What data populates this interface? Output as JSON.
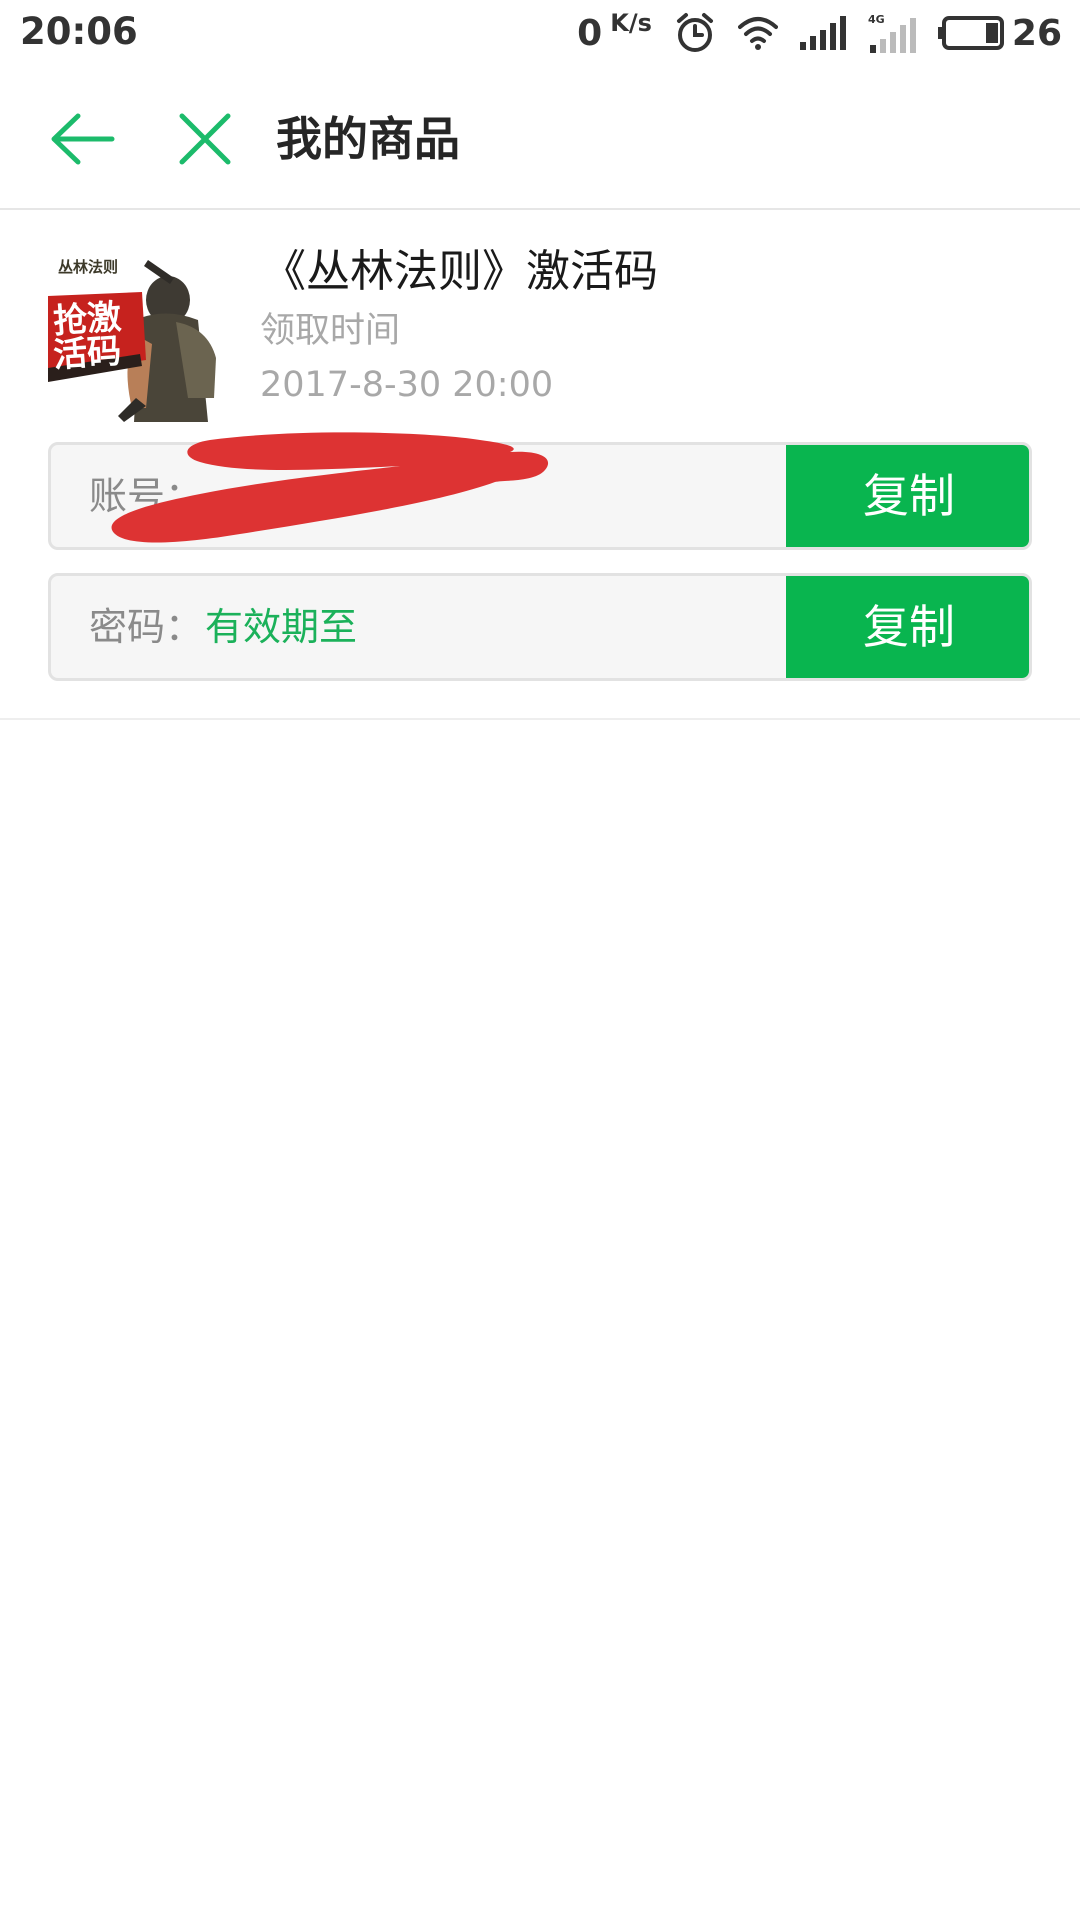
{
  "status_bar": {
    "time": "20:06",
    "net_speed_value": "0",
    "net_speed_unit": "K/s",
    "battery_percent": "26",
    "icons": [
      "alarm-icon",
      "wifi-icon",
      "signal-icon",
      "signal-4g-icon",
      "battery-icon"
    ]
  },
  "nav": {
    "title": "我的商品",
    "back_icon": "arrow-left-icon",
    "close_icon": "close-icon"
  },
  "product": {
    "title": "《丛林法则》激活码",
    "received_label": "领取时间",
    "received_date": "2017-8-30 20:00",
    "image_text_top": "丛林法则",
    "image_text_main": "抢激活码"
  },
  "account": {
    "label": "账号：",
    "value": "",
    "copy_label": "复制"
  },
  "password": {
    "label": "密码：",
    "value": "有效期至",
    "copy_label": "复制"
  },
  "colors": {
    "accent": "#09b54f",
    "value_text": "#1bb15a",
    "redaction": "#dd3333",
    "nav_icon": "#1cbb6b"
  }
}
